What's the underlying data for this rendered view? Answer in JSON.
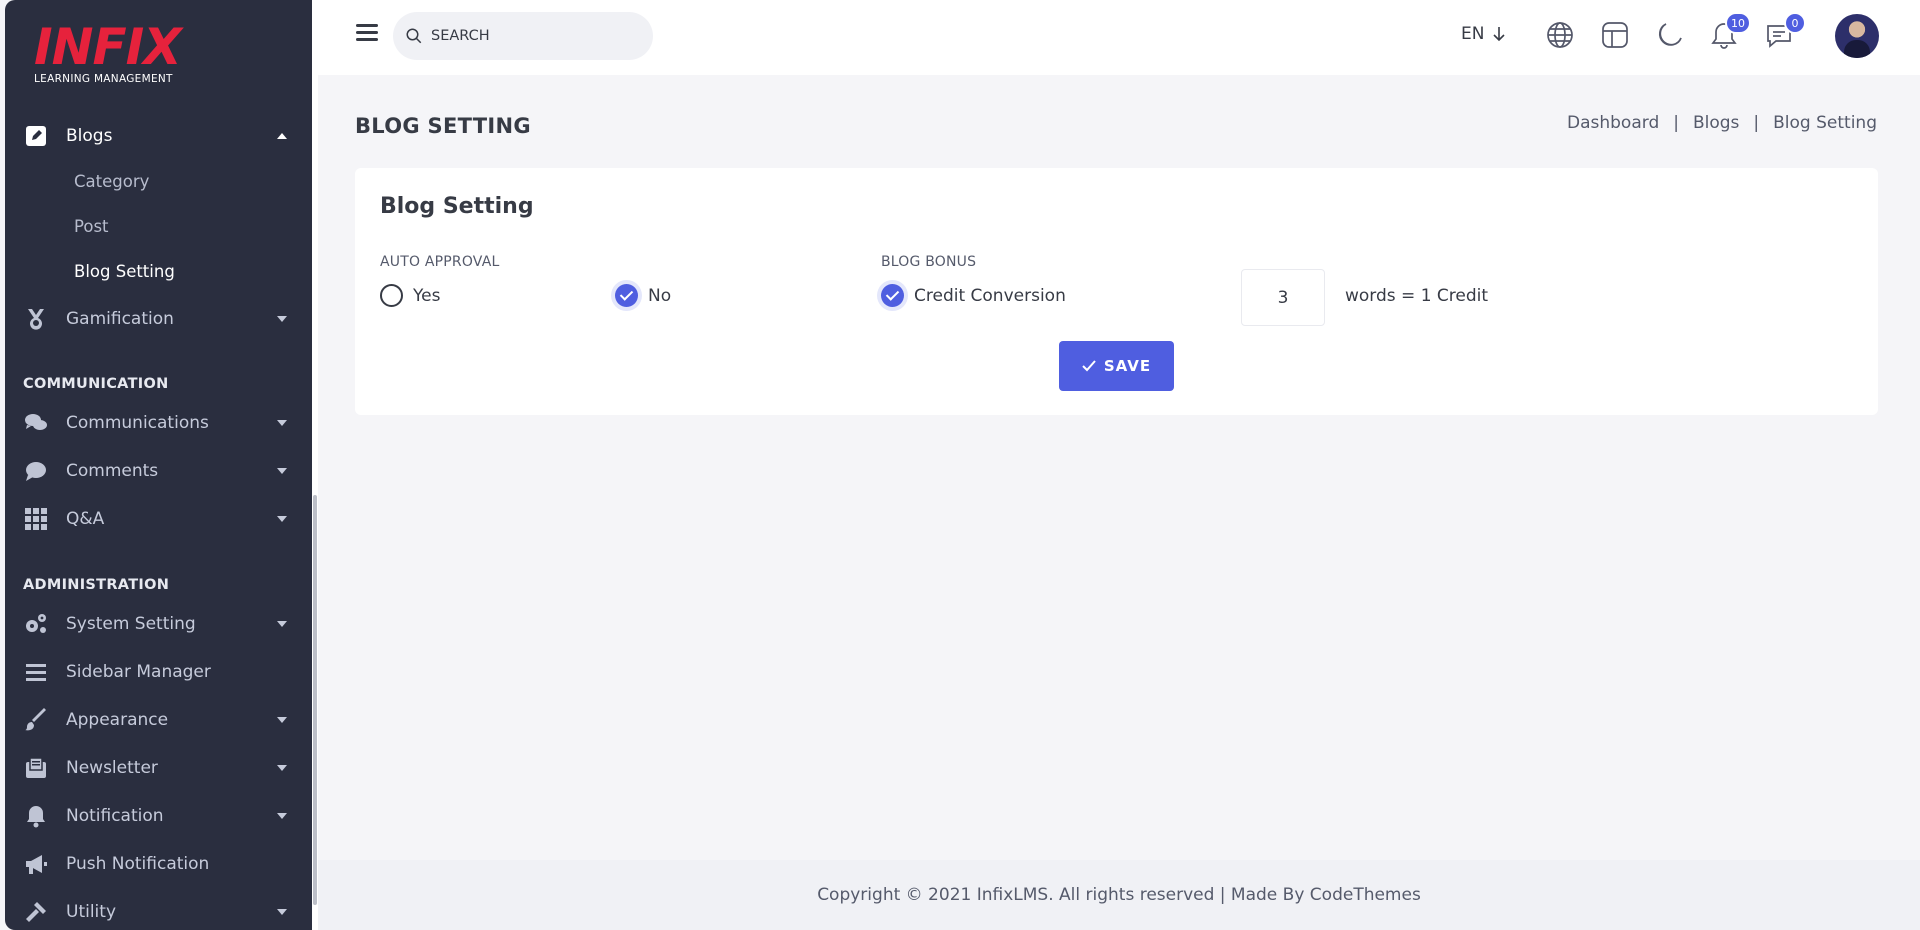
{
  "logo": {
    "word": "INFIX",
    "subtitle": "LEARNING MANAGEMENT"
  },
  "sidebar": {
    "blogs": {
      "label": "Blogs",
      "icon": "edit-icon",
      "expanded": true,
      "children": [
        {
          "label": "Category",
          "active": false
        },
        {
          "label": "Post",
          "active": false
        },
        {
          "label": "Blog Setting",
          "active": true
        }
      ]
    },
    "gamification": {
      "label": "Gamification",
      "icon": "medal-icon"
    },
    "communication_heading": "COMMUNICATION",
    "communications": {
      "label": "Communications",
      "icon": "chat-icon"
    },
    "comments": {
      "label": "Comments",
      "icon": "comment-icon"
    },
    "qa": {
      "label": "Q&A",
      "icon": "grid-icon"
    },
    "administration_heading": "ADMINISTRATION",
    "system_setting": {
      "label": "System Setting",
      "icon": "gears-icon"
    },
    "sidebar_manager": {
      "label": "Sidebar Manager",
      "icon": "bars-icon"
    },
    "appearance": {
      "label": "Appearance",
      "icon": "brush-icon"
    },
    "newsletter": {
      "label": "Newsletter",
      "icon": "newsletter-icon"
    },
    "notification": {
      "label": "Notification",
      "icon": "bell-icon"
    },
    "push_notification": {
      "label": "Push Notification",
      "icon": "megaphone-icon"
    },
    "utility": {
      "label": "Utility",
      "icon": "hammer-icon"
    }
  },
  "header": {
    "search_placeholder": "SEARCH",
    "language": "EN",
    "notification_count": "10",
    "message_count": "0"
  },
  "page": {
    "title": "BLOG SETTING",
    "breadcrumb": [
      "Dashboard",
      "Blogs",
      "Blog Setting"
    ],
    "breadcrumb_sep": "|"
  },
  "card": {
    "title": "Blog Setting",
    "auto_approval": {
      "label": "AUTO APPROVAL",
      "options": [
        "Yes",
        "No"
      ],
      "selected": "No"
    },
    "blog_bonus": {
      "label": "BLOG BONUS",
      "option": "Credit Conversion",
      "checked": true
    },
    "words_value": "3",
    "words_suffix": "words = 1 Credit",
    "save_label": "SAVE"
  },
  "footer": {
    "text": "Copyright © 2021 InfixLMS. All rights reserved | Made By CodeThemes"
  },
  "colors": {
    "accent": "#4f5ee0",
    "sidebar_bg": "#2a2e3f",
    "logo_red": "#e6223c"
  }
}
